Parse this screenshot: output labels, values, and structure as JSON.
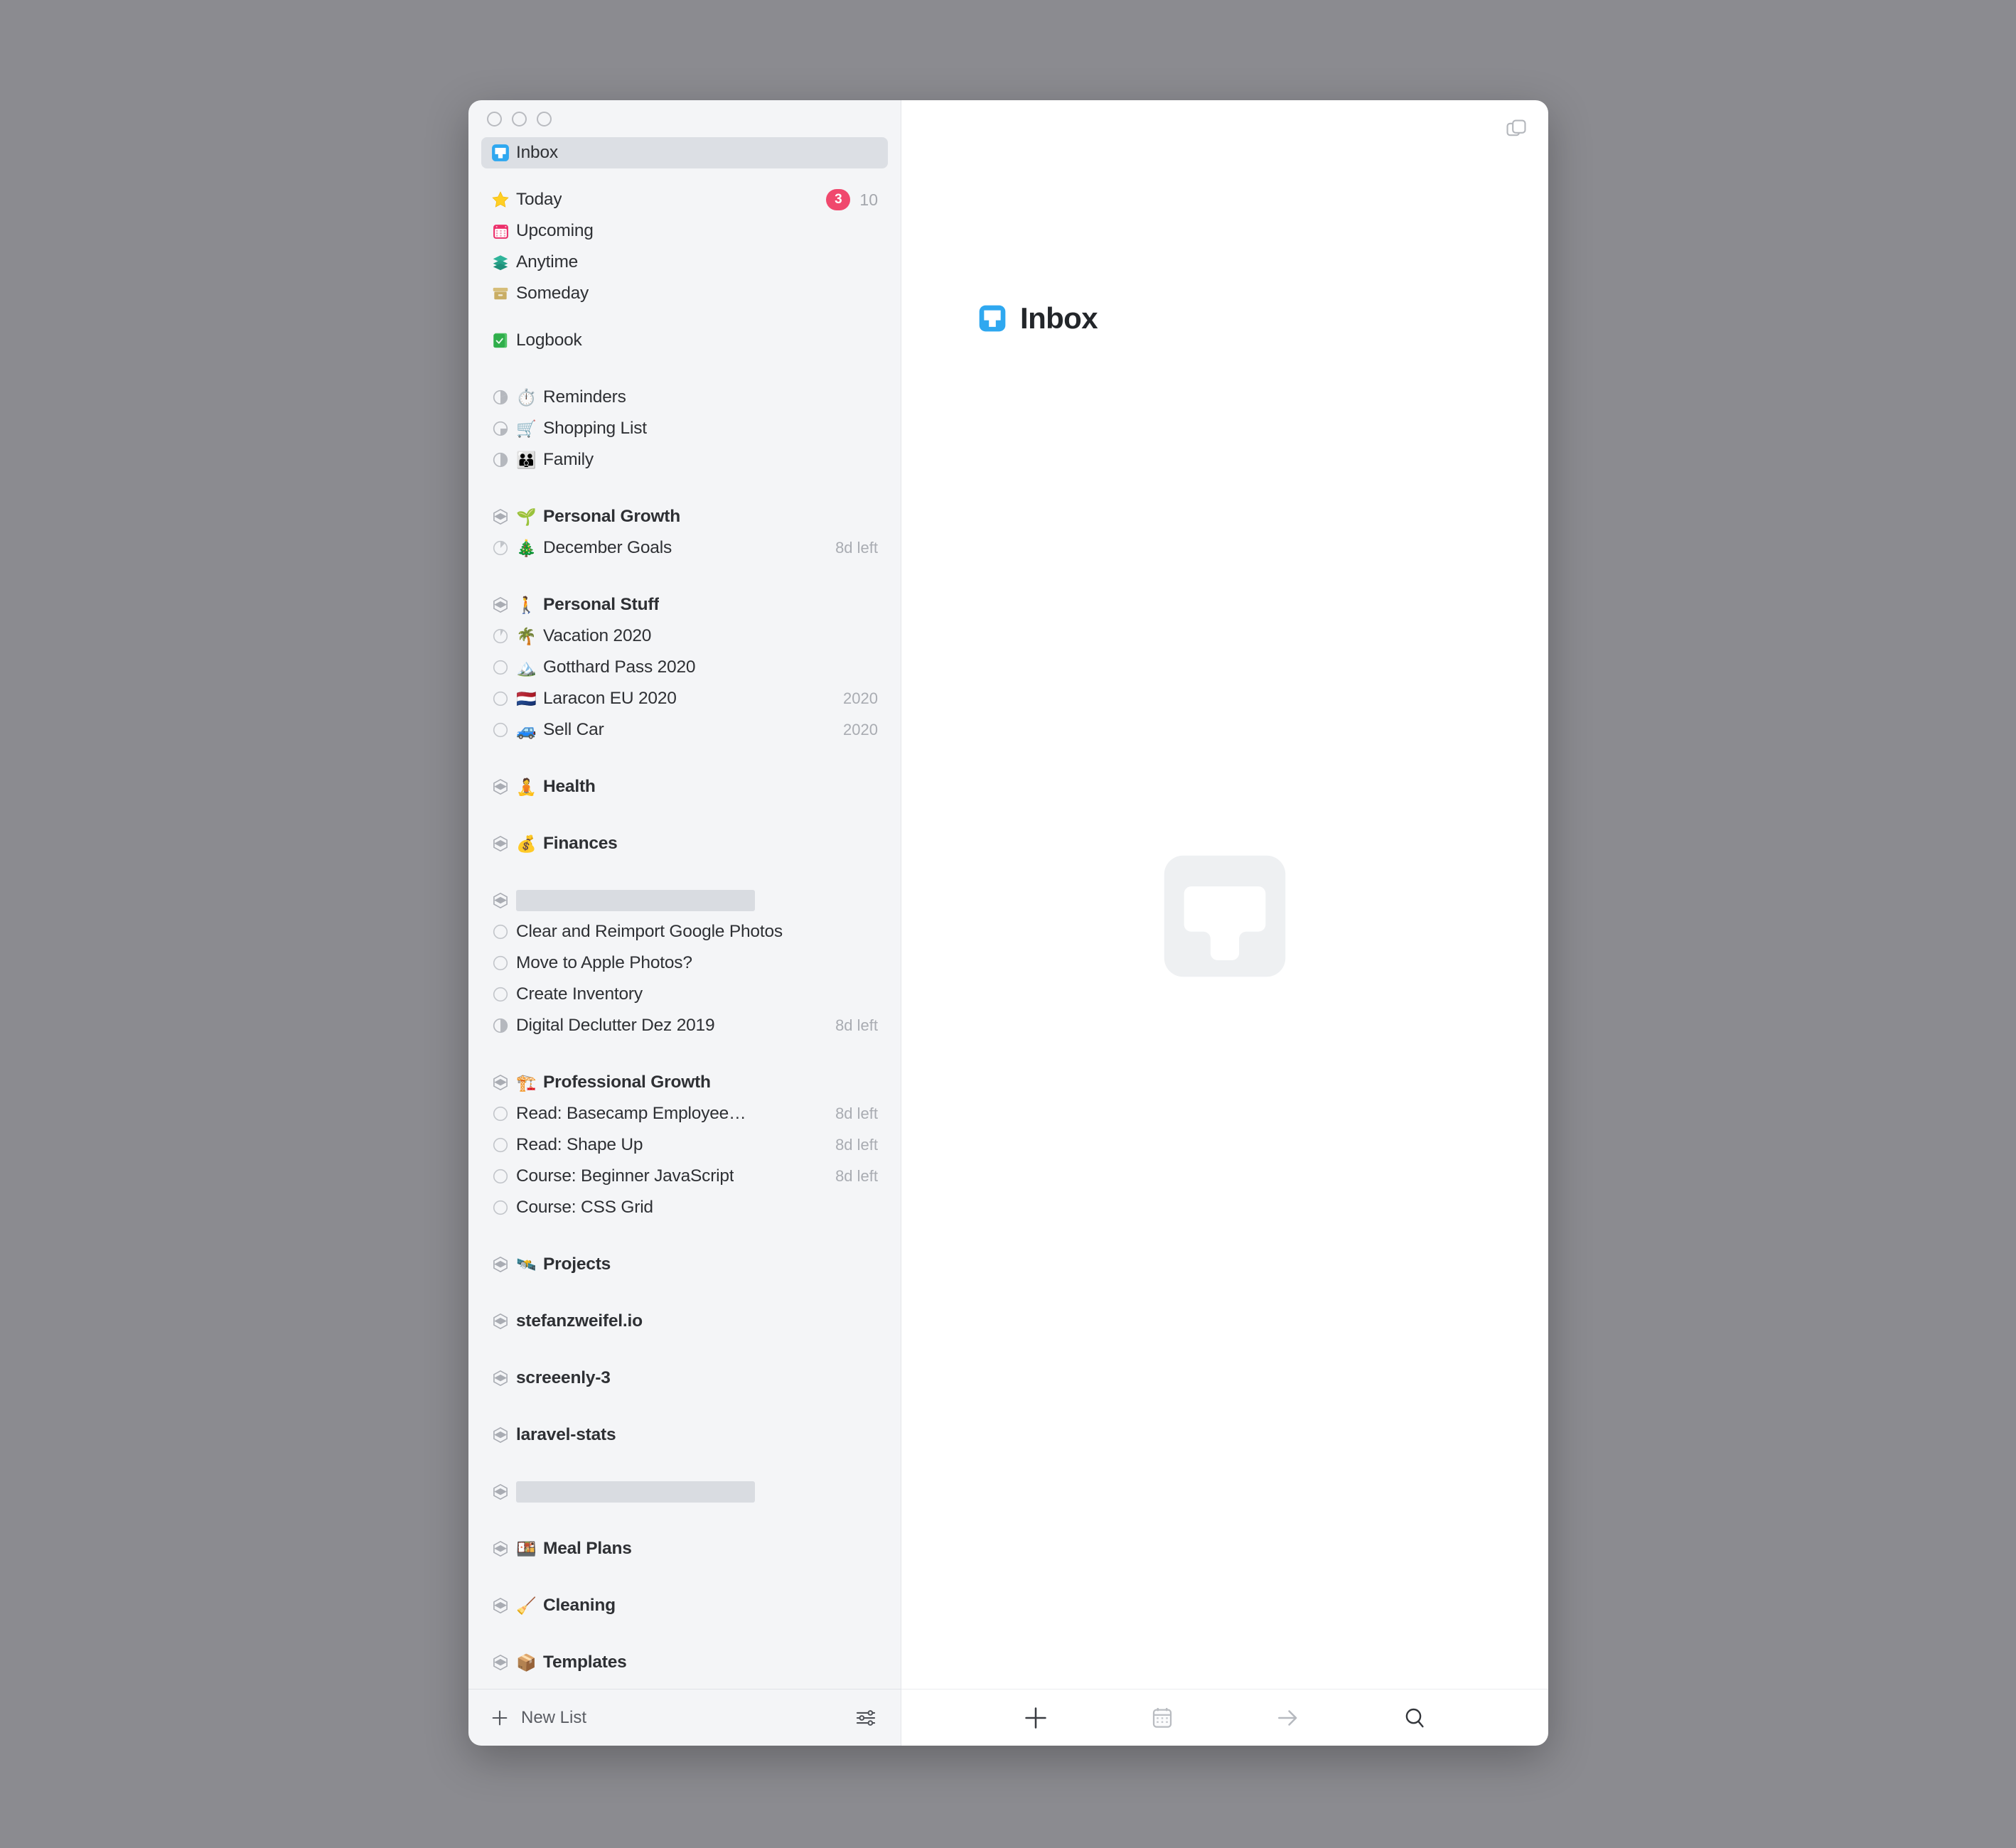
{
  "window": {
    "traffic_lights": [
      "close",
      "minimize",
      "zoom"
    ],
    "duplicate_icon": "duplicate-window-icon"
  },
  "sidebar": {
    "selected": "Inbox",
    "inbox": {
      "label": "Inbox",
      "icon": "inbox-tray-icon"
    },
    "smart_lists": [
      {
        "label": "Today",
        "icon": "star-icon",
        "badge": "3",
        "count": "10"
      },
      {
        "label": "Upcoming",
        "icon": "calendar-icon"
      },
      {
        "label": "Anytime",
        "icon": "layers-icon"
      },
      {
        "label": "Someday",
        "icon": "box-icon"
      }
    ],
    "logbook": {
      "label": "Logbook",
      "icon": "logbook-icon"
    },
    "lists": [
      {
        "label": "Reminders",
        "emoji": "⏱️",
        "progress": 40
      },
      {
        "label": "Shopping List",
        "emoji": "🛒",
        "progress": 30
      },
      {
        "label": "Family",
        "emoji": "👪",
        "progress": 50
      }
    ],
    "areas": [
      {
        "label": "Personal Growth",
        "emoji": "🌱",
        "projects": [
          {
            "label": "December Goals",
            "emoji": "🎄",
            "meta": "8d left",
            "progress": 12
          }
        ]
      },
      {
        "label": "Personal Stuff",
        "emoji": "🚶",
        "projects": [
          {
            "label": "Vacation 2020",
            "emoji": "🌴",
            "meta": "",
            "progress": 8
          },
          {
            "label": "Gotthard Pass 2020",
            "emoji": "🏔️",
            "meta": "",
            "progress": 0
          },
          {
            "label": "Laracon EU 2020",
            "emoji": "🇳🇱",
            "meta": "2020",
            "progress": 0
          },
          {
            "label": "Sell Car",
            "emoji": "🚙",
            "meta": "2020",
            "progress": 0
          }
        ]
      },
      {
        "label": "Health",
        "emoji": "🧘",
        "projects": []
      },
      {
        "label": "Finances",
        "emoji": "💰",
        "projects": []
      },
      {
        "label": "",
        "redacted": true,
        "projects": [
          {
            "label": "Clear and Reimport Google Photos",
            "meta": "",
            "progress": 0
          },
          {
            "label": "Move to Apple Photos?",
            "meta": "",
            "progress": 0
          },
          {
            "label": "Create Inventory",
            "meta": "",
            "progress": 0
          },
          {
            "label": "Digital Declutter Dez 2019",
            "meta": "8d left",
            "progress": 50
          }
        ]
      },
      {
        "label": "Professional Growth",
        "emoji": "🏗️",
        "projects": [
          {
            "label": "Read: Basecamp Employee…",
            "meta": "8d left",
            "progress": 0
          },
          {
            "label": "Read: Shape Up",
            "meta": "8d left",
            "progress": 0
          },
          {
            "label": "Course: Beginner JavaScript",
            "meta": "8d left",
            "progress": 0
          },
          {
            "label": "Course: CSS Grid",
            "meta": "",
            "progress": 0
          }
        ]
      },
      {
        "label": "Projects",
        "emoji": "🛰️",
        "projects": []
      },
      {
        "label": "stefanzweifel.io",
        "emoji": "",
        "projects": []
      },
      {
        "label": "screeenly-3",
        "emoji": "",
        "projects": []
      },
      {
        "label": "laravel-stats",
        "emoji": "",
        "projects": []
      },
      {
        "label": "",
        "redacted": true,
        "projects": []
      },
      {
        "label": "Meal Plans",
        "emoji": "🍱",
        "projects": []
      },
      {
        "label": "Cleaning",
        "emoji": "🧹",
        "projects": []
      },
      {
        "label": "Templates",
        "emoji": "📦",
        "projects": []
      }
    ],
    "footer": {
      "new_list_label": "New List",
      "new_list_icon": "plus-icon",
      "filter_icon": "sliders-icon"
    }
  },
  "main": {
    "title": "Inbox",
    "title_icon": "inbox-tray-icon",
    "watermark_icon": "inbox-tray-watermark",
    "toolbar": [
      {
        "icon": "plus-icon",
        "name": "new-todo-button"
      },
      {
        "icon": "calendar-icon",
        "name": "when-button"
      },
      {
        "icon": "arrow-right-icon",
        "name": "move-button"
      },
      {
        "icon": "search-icon",
        "name": "search-button"
      }
    ]
  },
  "colors": {
    "accent_blue": "#2fa8f0",
    "badge_red": "#f0486d",
    "sidebar_bg": "#f4f5f7",
    "selected_bg": "#dcdfe4",
    "redacted": "#d9dce1",
    "text": "#2e3034",
    "muted": "#a9acb2"
  }
}
